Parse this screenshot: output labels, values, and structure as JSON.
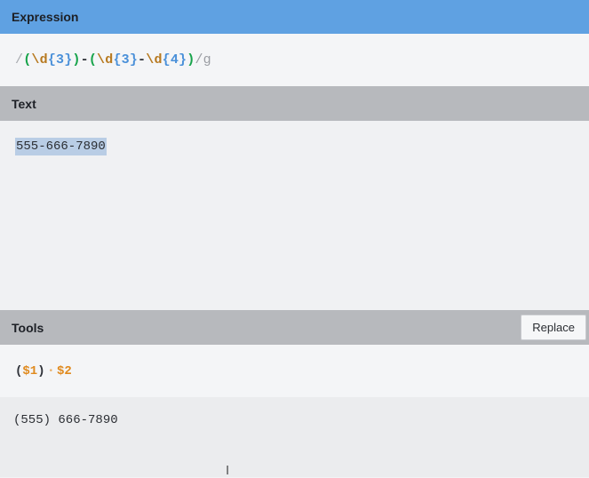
{
  "expression": {
    "header": "Expression",
    "tokens": [
      {
        "text": "/",
        "kind": "slash"
      },
      {
        "text": "(",
        "kind": "paren"
      },
      {
        "text": "\\d",
        "kind": "esc"
      },
      {
        "text": "{3}",
        "kind": "quant"
      },
      {
        "text": ")",
        "kind": "paren"
      },
      {
        "text": "-",
        "kind": "lit"
      },
      {
        "text": "(",
        "kind": "paren"
      },
      {
        "text": "\\d",
        "kind": "esc"
      },
      {
        "text": "{3}",
        "kind": "quant"
      },
      {
        "text": "-",
        "kind": "lit"
      },
      {
        "text": "\\d",
        "kind": "esc"
      },
      {
        "text": "{4}",
        "kind": "quant"
      },
      {
        "text": ")",
        "kind": "paren"
      },
      {
        "text": "/g",
        "kind": "flag"
      }
    ]
  },
  "text": {
    "header": "Text",
    "content": "555-666-7890"
  },
  "tools": {
    "header": "Tools",
    "replace_label": "Replace",
    "template": {
      "open": "(",
      "ref1": "$1",
      "close": ")",
      "space": "•",
      "ref2": "$2"
    },
    "result": "(555) 666-7890"
  },
  "colors": {
    "expression_header": "#5fa1e2",
    "section_header": "#b7b9bd",
    "selection": "#b9cde5",
    "group_paren": "#16a34a",
    "escape": "#b7791f",
    "quantifier": "#4a90d9",
    "reference": "#e08a1e"
  },
  "icons": {
    "cursor": "text-cursor-icon"
  }
}
